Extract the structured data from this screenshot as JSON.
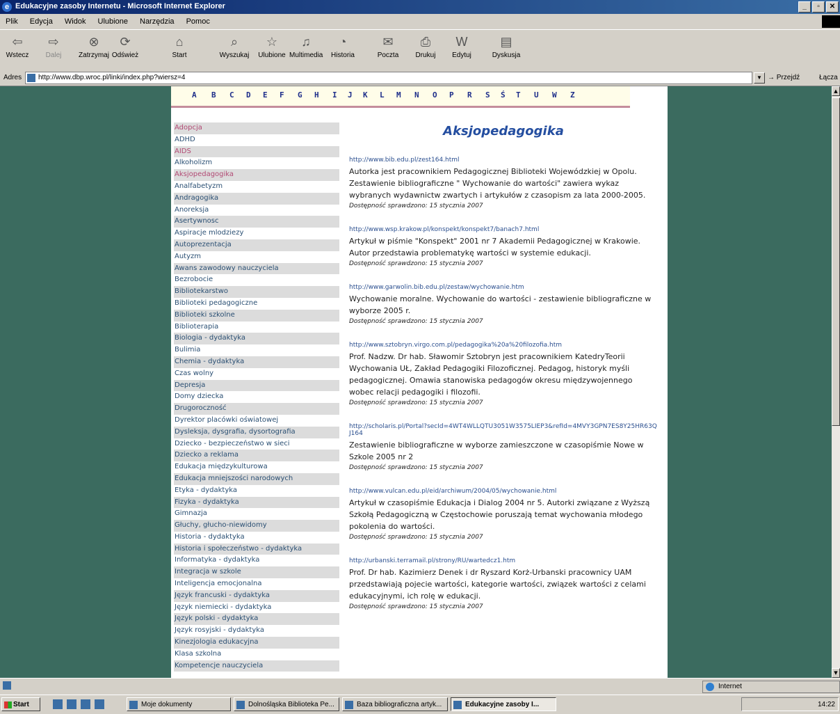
{
  "window": {
    "title": "Edukacyjne zasoby Internetu - Microsoft Internet Explorer"
  },
  "menu": [
    "Plik",
    "Edycja",
    "Widok",
    "Ulubione",
    "Narzędzia",
    "Pomoc"
  ],
  "toolbar": [
    {
      "label": "Wstecz",
      "icon": "back-icon"
    },
    {
      "label": "Dalej",
      "icon": "forward-icon"
    },
    {
      "label": "Zatrzymaj",
      "icon": "stop-icon"
    },
    {
      "label": "Odśwież",
      "icon": "refresh-icon"
    },
    {
      "label": "Start",
      "icon": "home-icon"
    },
    {
      "label": "Wyszukaj",
      "icon": "search-icon"
    },
    {
      "label": "Ulubione",
      "icon": "favorites-icon"
    },
    {
      "label": "Multimedia",
      "icon": "media-icon"
    },
    {
      "label": "Historia",
      "icon": "history-icon"
    },
    {
      "label": "Poczta",
      "icon": "mail-icon"
    },
    {
      "label": "Drukuj",
      "icon": "print-icon"
    },
    {
      "label": "Edytuj",
      "icon": "edit-icon"
    },
    {
      "label": "Dyskusja",
      "icon": "discuss-icon"
    }
  ],
  "address": {
    "label": "Adres",
    "url": "http://www.dbp.wroc.pl/linki/index.php?wiersz=4",
    "go": "Przejdź",
    "links": "Łącza"
  },
  "alphabet": [
    "A",
    "B",
    "C",
    "D",
    "E",
    "F",
    "G",
    "H",
    "I",
    "J",
    "K",
    "L",
    "M",
    "N",
    "O",
    "P",
    "R",
    "S",
    "Ś",
    "T",
    "U",
    "W",
    "Z"
  ],
  "sidebar": [
    "Adopcja",
    "ADHD",
    "AIDS",
    "Alkoholizm",
    "Aksjopedagogika",
    "Analfabetyzm",
    "Andragogika",
    "Anoreksja",
    "Asertywnosc",
    "Aspiracje mlodziezy",
    "Autoprezentacja",
    "Autyzm",
    "Awans zawodowy nauczyciela",
    "Bezrobocie",
    "Bibliotekarstwo",
    "Biblioteki pedagogiczne",
    "Biblioteki szkolne",
    "Biblioterapia",
    "Biologia - dydaktyka",
    "Bulimia",
    "Chemia - dydaktyka",
    "Czas wolny",
    "Depresja",
    "Domy dziecka",
    "Drugoroczność",
    "Dyrektor placówki oświatowej",
    "Dysleksja, dysgrafia, dysortografia",
    "Dziecko - bezpieczeństwo w sieci",
    "Dziecko a reklama",
    "Edukacja międzykulturowa",
    "Edukacja mniejszości narodowych",
    "Etyka - dydaktyka",
    "Fizyka - dydaktyka",
    "Gimnazja",
    "Głuchy, głucho-niewidomy",
    "Historia - dydaktyka",
    "Historia i społeczeństwo - dydaktyka",
    "Informatyka - dydaktyka",
    "Integracja w szkole",
    "Inteligencja emocjonalna",
    "Język francuski - dydaktyka",
    "Język niemiecki - dydaktyka",
    "Język polski - dydaktyka",
    "Język rosyjski - dydaktyka",
    "Kinezjologia edukacyjna",
    "Klasa szkolna",
    "Kompetencje nauczyciela"
  ],
  "content": {
    "heading": "Aksjopedagogika",
    "entries": [
      {
        "url": "http://www.bib.edu.pl/zest164.html",
        "desc": "Autorka jest pracownikiem Pedagogicznej Biblioteki Wojewódzkiej w Opolu. Zestawienie bibliograficzne \" Wychowanie do wartości\" zawiera wykaz wybranych wydawnictw zwartych i artykułów z czasopism za lata 2000-2005.",
        "check": "Dostępność sprawdzono: 15 stycznia 2007"
      },
      {
        "url": "http://www.wsp.krakow.pl/konspekt/konspekt7/banach7.html",
        "desc": "Artykuł w piśmie \"Konspekt\" 2001 nr 7 Akademii Pedagogicznej w Krakowie. Autor przedstawia problematykę wartości w systemie edukacji.",
        "check": "Dostępność sprawdzono: 15 stycznia 2007"
      },
      {
        "url": "http://www.garwolin.bib.edu.pl/zestaw/wychowanie.htm",
        "desc": "Wychowanie moralne. Wychowanie do wartości - zestawienie bibliograficzne w wyborze 2005 r.",
        "check": "Dostępność sprawdzono: 15 stycznia 2007"
      },
      {
        "url": "http://www.sztobryn.virgo.com.pl/pedagogika%20a%20filozofia.htm",
        "desc": "Prof. Nadzw. Dr hab. Sławomir Sztobryn jest pracownikiem KatedryTeorii Wychowania UŁ, Zakład Pedagogiki Filozoficznej. Pedagog, historyk myśli pedagogicznej. Omawia stanowiska pedagogów okresu międzywojennego wobec relacji pedagogiki i filozofii.",
        "check": "Dostępność sprawdzono: 15 stycznia 2007"
      },
      {
        "url": "http://scholaris.pl/Portal?secId=4WT4WLLQTU3051W3575LIEP3&refId=4MVY3GPN7ES8Y25HR63QJ164",
        "desc": "Zestawienie bibliograficzne w wyborze zamieszczone w czasopiśmie Nowe w Szkole 2005 nr 2",
        "check": "Dostępność sprawdzono: 15 stycznia 2007"
      },
      {
        "url": "http://www.vulcan.edu.pl/eid/archiwum/2004/05/wychowanie.html",
        "desc": "Artykuł w czasopiśmie Edukacja i Dialog 2004 nr 5. Autorki związane z Wyższą Szkołą Pedagogiczną w Częstochowie poruszają temat wychowania młodego pokolenia do wartości.",
        "check": "Dostępność sprawdzono: 15 stycznia 2007"
      },
      {
        "url": "http://urbanski.terramail.pl/strony/RU/wartedcz1.htm",
        "desc": "Prof. Dr hab. Kazimierz Denek i dr Ryszard Korż-Urbanski pracownicy UAM przedstawiają pojecie wartości, kategorie wartości, związek wartości z celami edukacyjnymi, ich rolę w edukacji.",
        "check": "Dostępność sprawdzono: 15 stycznia 2007"
      }
    ]
  },
  "status": {
    "zone": "Internet"
  },
  "taskbar": {
    "start": "Start",
    "tasks": [
      "Moje dokumenty",
      "Dolnośląska Biblioteka Pe...",
      "Baza bibliograficzna artyk...",
      "Edukacyjne zasoby I..."
    ],
    "clock": "14:22"
  },
  "colors": {
    "page_bg": "#3b6b5f",
    "heading": "#244ea0",
    "link": "#2b4f8f",
    "sidebar_link": "#2a4f73",
    "sidebar_active": "#b24a74",
    "divider": "#c48d9c"
  }
}
